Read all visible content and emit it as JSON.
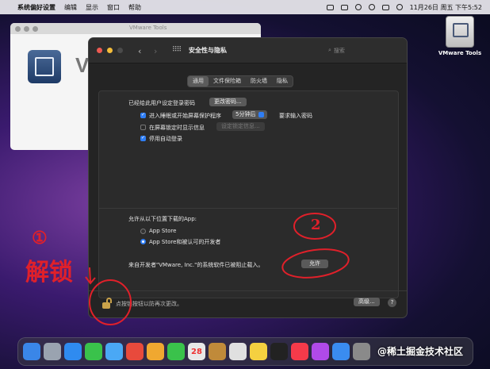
{
  "menubar": {
    "apple": "",
    "items": [
      "系统偏好设置",
      "编辑",
      "显示",
      "窗口",
      "帮助"
    ],
    "clock": "11月26日 周五 下午5:52"
  },
  "desktop": {
    "icon_label": "VMware Tools"
  },
  "bg_window": {
    "title": "VMware Tools",
    "big_text": "V"
  },
  "window": {
    "title": "安全性与隐私",
    "back": "‹",
    "forward": "›",
    "grid": "⠿⠿",
    "search_placeholder": "搜索",
    "tabs": [
      "通用",
      "文件保险箱",
      "防火墙",
      "隐私"
    ],
    "password_set_text": "已经给此用户设定登录密码",
    "change_password_btn": "更改密码...",
    "require_pw_label": "进入睡眠或开始屏幕保护程序",
    "require_pw_option": "5分钟后",
    "require_pw_suffix": "要求输入密码",
    "show_message_label": "在屏幕锁定时显示信息",
    "set_lock_message_btn": "设定锁定信息...",
    "disable_autologin_label": "停用自动登录",
    "allow_apps_label": "允许从以下位置下载的App:",
    "radio_app_store": "App Store",
    "radio_app_store_dev": "App Store和被认可的开发者",
    "blocked_text": "来自开发者\"VMware, Inc.\"的系统软件已被阻止载入。",
    "allow_btn": "允许",
    "lock_text": "点按锁按钮以防再次更改。",
    "advanced_btn": "高级...",
    "help": "?"
  },
  "annotations": {
    "one": "①",
    "unlock": "解锁",
    "two": "2"
  },
  "dock": {
    "colors": [
      "#3a86e8",
      "#9aa3b0",
      "#2f8bf0",
      "#3ac24b",
      "#4aa8f5",
      "#e84a3c",
      "#f0a830",
      "#3ac24b",
      "#e8e8e8",
      "#c08a3a",
      "#e0e0e0",
      "#f5d040",
      "#222222",
      "#f53a4a",
      "#b04ae8",
      "#3a8cf0",
      "#8a8a8a"
    ],
    "calendar_day": "28"
  },
  "watermark": "@稀土掘金技术社区"
}
